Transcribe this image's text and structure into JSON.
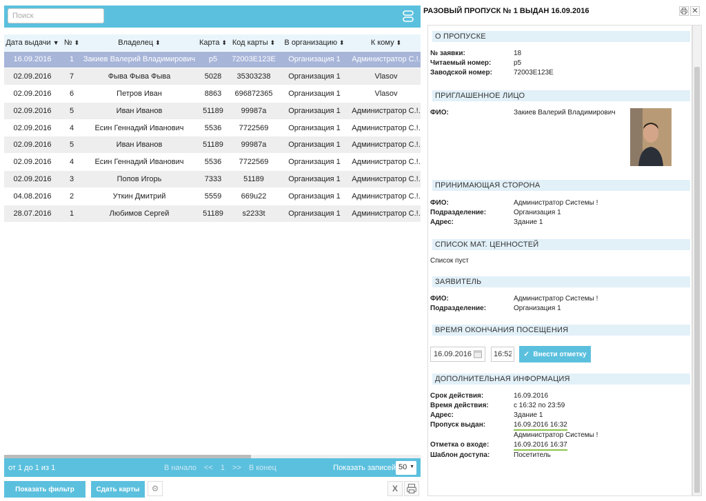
{
  "search": {
    "placeholder": "Поиск"
  },
  "table": {
    "columns": [
      "Дата выдачи",
      "№",
      "Владелец",
      "Карта",
      "Код карты",
      "В организацию",
      "К кому"
    ],
    "rows": [
      [
        "16.09.2016",
        "1",
        "Закиев Валерий Владимирович",
        "p5",
        "72003E123E",
        "Организация 1",
        "Администратор С.!."
      ],
      [
        "02.09.2016",
        "7",
        "Фыва Фыва Фыва",
        "5028",
        "35303238",
        "Организация 1",
        "Vlasov"
      ],
      [
        "02.09.2016",
        "6",
        "Петров Иван",
        "8863",
        "696872365",
        "Организация 1",
        "Vlasov"
      ],
      [
        "02.09.2016",
        "5",
        "Иван Иванов",
        "51189",
        "99987a",
        "Организация 1",
        "Администратор С.!."
      ],
      [
        "02.09.2016",
        "4",
        "Есин Геннадий Иванович",
        "5536",
        "7722569",
        "Организация 1",
        "Администратор С.!."
      ],
      [
        "02.09.2016",
        "5",
        "Иван Иванов",
        "51189",
        "99987a",
        "Организация 1",
        "Администратор С.!."
      ],
      [
        "02.09.2016",
        "4",
        "Есин Геннадий Иванович",
        "5536",
        "7722569",
        "Организация 1",
        "Администратор С.!."
      ],
      [
        "02.09.2016",
        "3",
        "Попов Игорь",
        "7333",
        "51189",
        "Организация 1",
        "Администратор С.!."
      ],
      [
        "04.08.2016",
        "2",
        "Уткин Дмитрий",
        "5559",
        "669u22",
        "Организация 1",
        "Администратор С.!."
      ],
      [
        "28.07.2016",
        "1",
        "Любимов Сергей",
        "51189",
        "s2233t",
        "Организация 1",
        "Администратор С.!."
      ]
    ]
  },
  "pager": {
    "info": "от 1 до 1 из 1",
    "first": "В начало",
    "prev": "<<",
    "page": "1",
    "next": ">>",
    "last": "В конец",
    "show_label": "Показать записей",
    "per_page": "50"
  },
  "buttons": {
    "filter": "Показать фильтр",
    "cards": "Сдать карты"
  },
  "panel": {
    "title": "РАЗОВЫЙ ПРОПУСК № 1 ВЫДАН 16.09.2016",
    "about": {
      "header": "О ПРОПУСКЕ",
      "req_label": "№ заявки:",
      "req": "18",
      "readable_label": "Читаемый номер:",
      "readable": "p5",
      "factory_label": "Заводской номер:",
      "factory": "72003E123E"
    },
    "invited": {
      "header": "ПРИГЛАШЕННОЕ ЛИЦО",
      "fio_label": "ФИО:",
      "fio": "Закиев Валерий Владимирович"
    },
    "host": {
      "header": "ПРИНИМАЮЩАЯ СТОРОНА",
      "fio_label": "ФИО:",
      "fio": "Администратор Системы !",
      "dept_label": "Подразделение:",
      "dept": "Организация 1",
      "addr_label": "Адрес:",
      "addr": "Здание 1"
    },
    "assets": {
      "header": "СПИСОК МАТ. ЦЕННОСТЕЙ",
      "empty": "Список пуст"
    },
    "applicant": {
      "header": "ЗАЯВИТЕЛЬ",
      "fio_label": "ФИО:",
      "fio": "Администратор Системы !",
      "dept_label": "Подразделение:",
      "dept": "Организация 1"
    },
    "visit_end": {
      "header": "ВРЕМЯ ОКОНЧАНИЯ ПОСЕЩЕНИЯ",
      "date": "16.09.2016",
      "time": "16:52",
      "button": "Внести отметку"
    },
    "extra": {
      "header": "ДОПОЛНИТЕЛЬНАЯ ИНФОРМАЦИЯ",
      "valid_label": "Срок действия:",
      "valid": "16.09.2016",
      "time_label": "Время действия:",
      "time": "с 16:32 по 23:59",
      "addr_label": "Адрес:",
      "addr": "Здание 1",
      "issued_label": "Пропуск выдан:",
      "issued": "16.09.2016 16:32",
      "issued_by": "Администратор Системы !",
      "entry_label": "Отметка о входе:",
      "entry": "16.09.2016 16:37",
      "template_label": "Шаблон доступа:",
      "template": "Посетитель"
    }
  },
  "colors": {
    "accent": "#5bc0de",
    "selected_row": "#a7b5d9",
    "section_bg": "#e2f0f8"
  }
}
